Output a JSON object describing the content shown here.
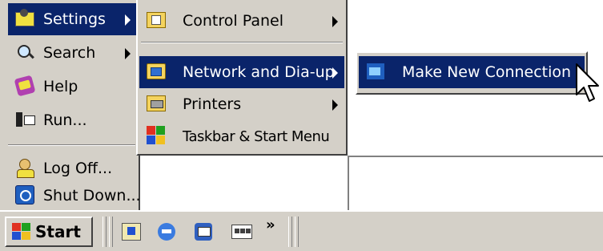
{
  "start_menu": {
    "items": [
      {
        "label": "Settings",
        "icon": "settings-icon",
        "has_submenu": true,
        "highlighted": true
      },
      {
        "label": "Search",
        "icon": "search-icon",
        "has_submenu": true
      },
      {
        "label": "Help",
        "icon": "help-icon"
      },
      {
        "label": "Run...",
        "icon": "run-icon"
      },
      {
        "label": "Log Off...",
        "icon": "log-off-icon"
      },
      {
        "label": "Shut Down...",
        "icon": "shut-down-icon"
      }
    ]
  },
  "settings_menu": {
    "items": [
      {
        "label": "Control Panel",
        "icon": "control-panel-icon",
        "has_submenu": true
      },
      {
        "label": "Network and Dia-up",
        "icon": "network-folder-icon",
        "has_submenu": true,
        "highlighted": true
      },
      {
        "label": "Printers",
        "icon": "printers-icon",
        "has_submenu": true
      },
      {
        "label": "Taskbar & Start Menu",
        "icon": "taskbar-icon"
      }
    ]
  },
  "network_menu": {
    "items": [
      {
        "label": "Make New Connection",
        "icon": "make-new-connection-icon",
        "highlighted": true
      }
    ]
  },
  "taskbar": {
    "start_label": "Start",
    "quick_launch": [
      "show-desktop-icon",
      "internet-explorer-icon",
      "outlook-express-icon",
      "media-icon"
    ],
    "overflow_label": "»"
  },
  "colors": {
    "menu_bg": "#d4d0c8",
    "highlight": "#0a246a",
    "highlight_text": "#ffffff"
  }
}
